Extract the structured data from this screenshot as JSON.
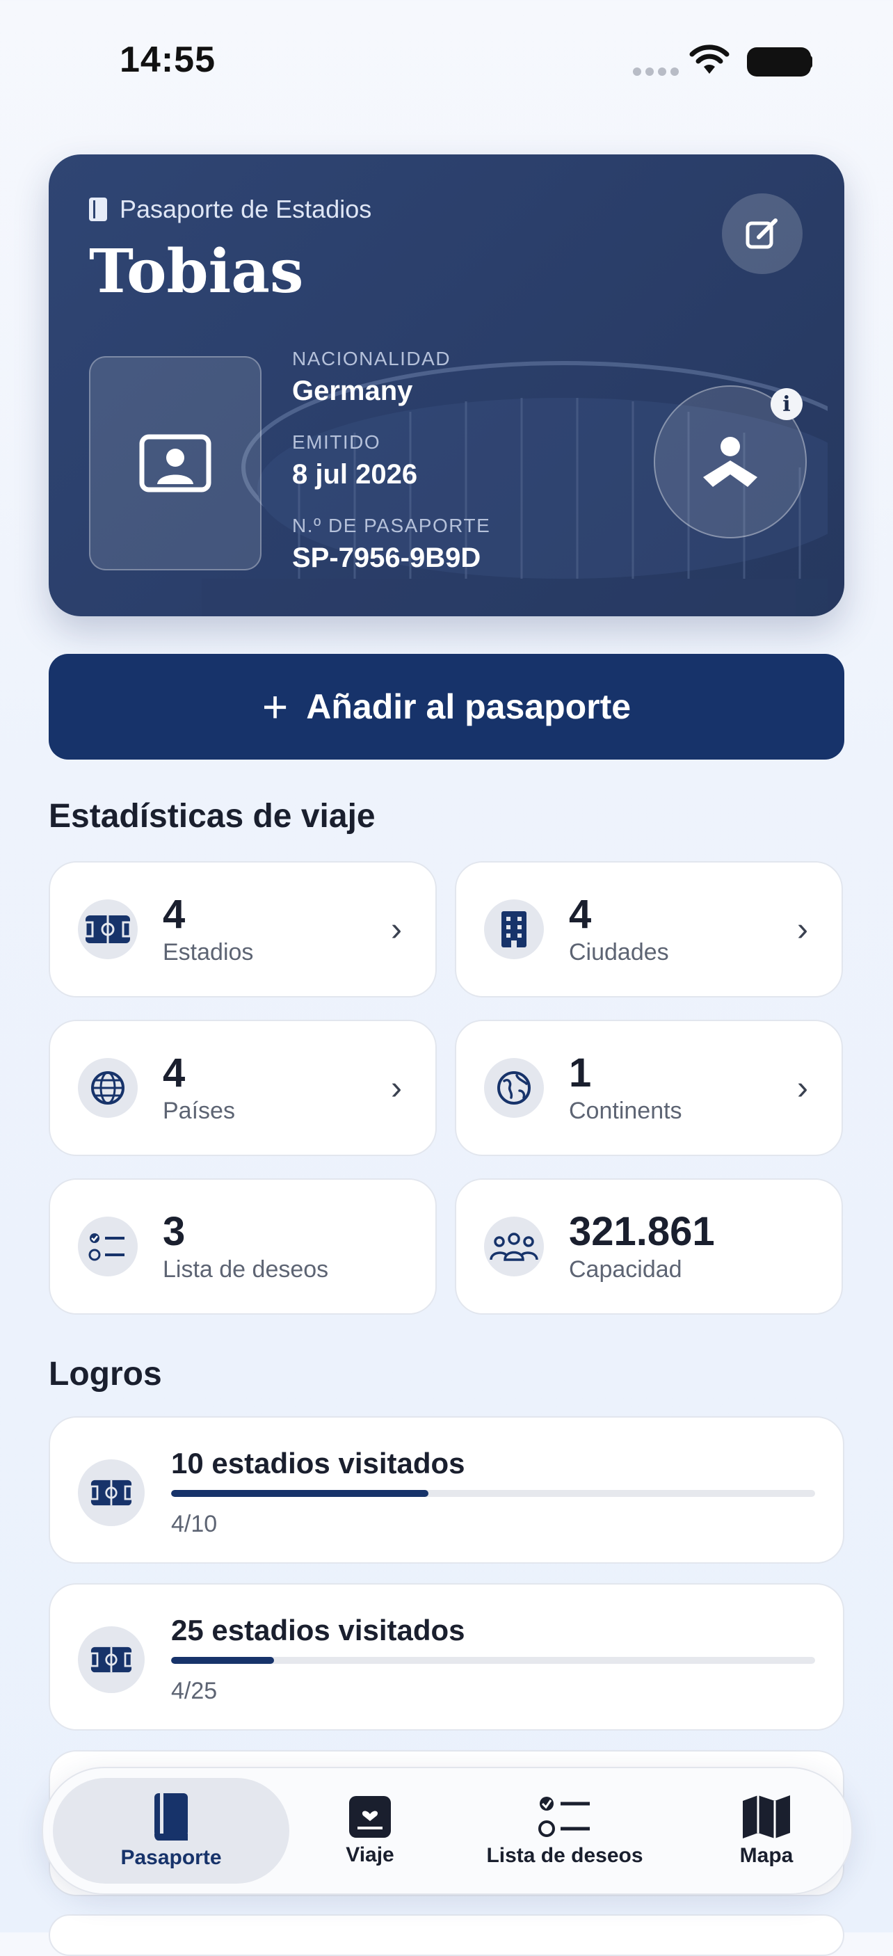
{
  "status_bar": {
    "time": "14:55"
  },
  "passport": {
    "kicker": "Pasaporte de Estadios",
    "name": "Tobias",
    "nationality_label": "NACIONALIDAD",
    "nationality": "Germany",
    "issued_label": "EMITIDO",
    "issued": "8 jul 2026",
    "number_label": "N.º DE PASAPORTE",
    "number": "SP-7956-9B9D"
  },
  "add_button": {
    "label": "Añadir al pasaporte"
  },
  "stats": {
    "title": "Estadísticas de viaje",
    "items": [
      {
        "value": "4",
        "label": "Estadios",
        "icon": "stadium-icon"
      },
      {
        "value": "4",
        "label": "Ciudades",
        "icon": "building-icon"
      },
      {
        "value": "4",
        "label": "Países",
        "icon": "globe-icon"
      },
      {
        "value": "1",
        "label": "Continents",
        "icon": "earth-icon"
      },
      {
        "value": "3",
        "label": "Lista de deseos",
        "icon": "checklist-icon"
      },
      {
        "value": "321.861",
        "label": "Capacidad",
        "icon": "people-icon"
      }
    ]
  },
  "achievements": {
    "title": "Logros",
    "items": [
      {
        "title": "10 estadios visitados",
        "progress_text": "4/10",
        "progress": 0.4
      },
      {
        "title": "25 estadios visitados",
        "progress_text": "4/25",
        "progress": 0.16
      }
    ]
  },
  "tabbar": {
    "tabs": [
      {
        "label": "Pasaporte",
        "active": true
      },
      {
        "label": "Viaje",
        "active": false
      },
      {
        "label": "Lista de deseos",
        "active": false
      },
      {
        "label": "Mapa",
        "active": false
      }
    ]
  },
  "colors": {
    "navy": "#17336a",
    "card": "#2b3f6b"
  }
}
